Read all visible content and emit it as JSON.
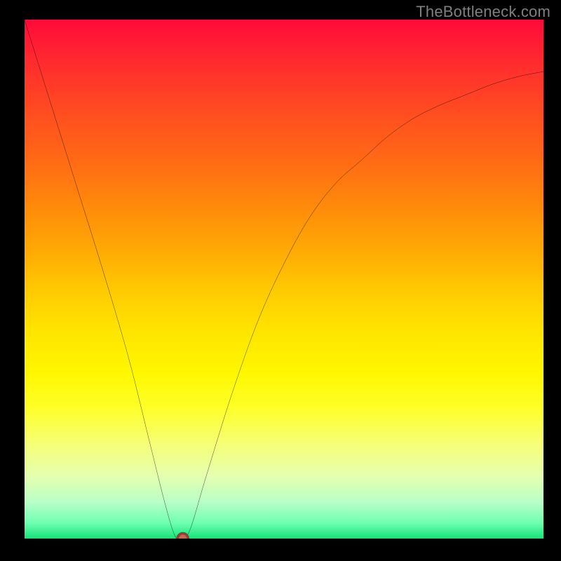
{
  "watermark": "TheBottleneck.com",
  "chart_data": {
    "type": "line",
    "title": "",
    "xlabel": "",
    "ylabel": "",
    "xlim": [
      0,
      100
    ],
    "ylim": [
      0,
      100
    ],
    "grid": false,
    "legend": false,
    "background_gradient": {
      "top_color": "#ff0a3a",
      "bottom_color": "#14e47a",
      "description": "Vertical rainbow gradient red→orange→yellow→green"
    },
    "series": [
      {
        "name": "bottleneck-curve",
        "color": "#000000",
        "x": [
          0,
          5,
          10,
          15,
          20,
          24,
          27,
          29,
          30.5,
          32,
          35,
          40,
          45,
          50,
          55,
          60,
          65,
          70,
          75,
          80,
          85,
          90,
          95,
          100
        ],
        "values": [
          100,
          84,
          68,
          52,
          35,
          19,
          7,
          0.5,
          0,
          2,
          12,
          28,
          42,
          53,
          62,
          68.5,
          73,
          77.5,
          81,
          83.5,
          85.5,
          87.5,
          89,
          90
        ]
      }
    ],
    "minimum_point": {
      "x": 30.5,
      "y": 0,
      "color": "#cc6655"
    }
  }
}
